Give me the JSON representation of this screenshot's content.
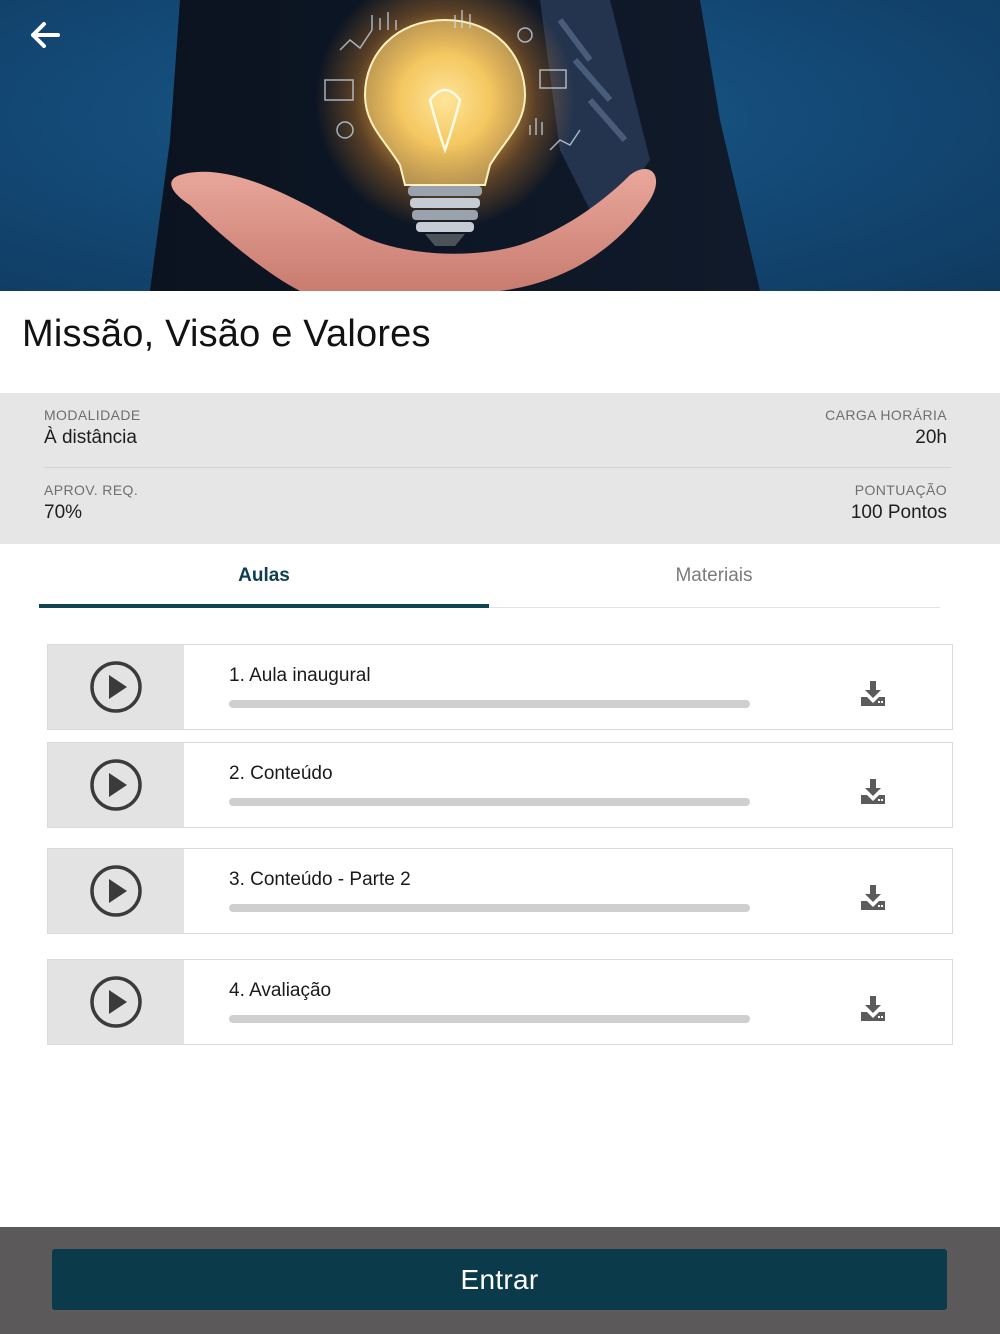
{
  "course": {
    "title": "Missão, Visão e Valores"
  },
  "info": {
    "modalidade_label": "MODALIDADE",
    "modalidade_value": "À distância",
    "carga_label": "CARGA HORÁRIA",
    "carga_value": "20h",
    "aprov_label": "APROV. REQ.",
    "aprov_value": "70%",
    "pontuacao_label": "PONTUAÇÃO",
    "pontuacao_value": "100 Pontos"
  },
  "tabs": [
    {
      "label": "Aulas",
      "active": true
    },
    {
      "label": "Materiais",
      "active": false
    }
  ],
  "lessons": [
    {
      "title": "1. Aula inaugural",
      "progress": 0
    },
    {
      "title": "2. Conteúdo",
      "progress": 0
    },
    {
      "title": "3. Conteúdo - Parte 2",
      "progress": 0
    },
    {
      "title": "4. Avaliação",
      "progress": 0
    }
  ],
  "footer": {
    "enter_label": "Entrar"
  },
  "icons": {
    "back": "arrow-left-icon",
    "play": "play-circle-icon",
    "download": "download-icon"
  },
  "colors": {
    "accent": "#0c4454",
    "button": "#0b3a4a",
    "footer_bg": "#5b5959",
    "info_bg": "#e6e6e6"
  }
}
